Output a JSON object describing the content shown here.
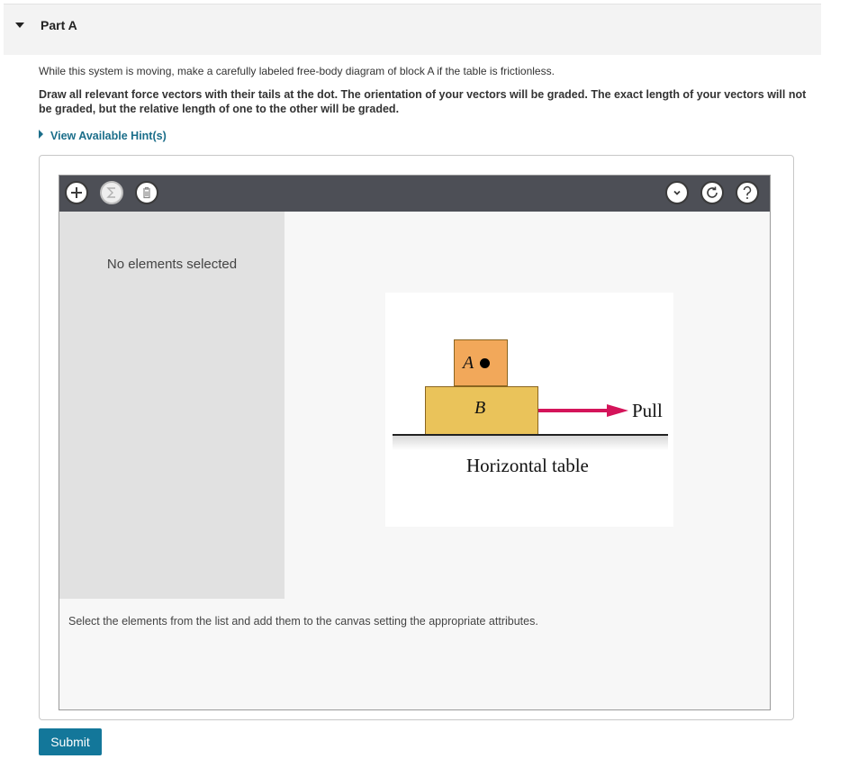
{
  "part": {
    "title": "Part A"
  },
  "instructions": {
    "line1": "While this system is moving, make a carefully labeled free-body diagram of block A if the table is frictionless.",
    "line2": "Draw all relevant force vectors with their tails at the dot. The orientation of your vectors will be graded. The exact length of your vectors will not be graded, but the relative length of one to the other will be graded."
  },
  "hint": {
    "label": "View Available Hint(s)"
  },
  "toolbar": {
    "add_icon": "plus-icon",
    "sum_icon": "sigma-icon",
    "delete_icon": "trash-icon",
    "menu_icon": "chevron-down-icon",
    "reset_icon": "reset-icon",
    "help_icon": "help-icon"
  },
  "sidebar": {
    "empty_text": "No elements selected"
  },
  "figure": {
    "block_a": "A",
    "block_b": "B",
    "force_label": "Pull",
    "table_label": "Horizontal table",
    "arrow_color": "#d4145a"
  },
  "canvas": {
    "instructions": "Select the elements from the list and add them to the canvas setting the appropriate attributes."
  },
  "submit": {
    "label": "Submit"
  }
}
